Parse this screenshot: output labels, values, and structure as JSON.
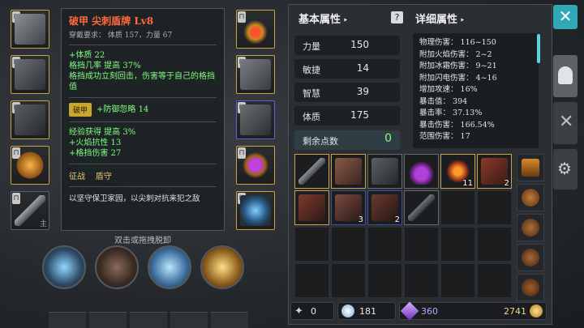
{
  "tooltip": {
    "title": "破甲 尖刺盾牌 Lv8",
    "requirement": "穿戴要求： 体质 157，力量 67",
    "stats": [
      "+体质 22",
      "格挡几率 提高 37%",
      "格挡成功立刻回击，伤害等于自己的格挡值"
    ],
    "set_badge": "破甲",
    "set_bonus": "+防御忽略 14",
    "extra": [
      "经验获得 提高 3%",
      "+火焰抗性 13",
      "+格挡伤害 27"
    ],
    "tags": "征战    盾守",
    "description": "以坚守保卫家园，以尖刺对抗来犯之敌"
  },
  "hint": "双击或拖拽脱卸",
  "slot_tag": "主",
  "panel": {
    "basic_title": "基本属性",
    "detail_title": "详细属性",
    "stats": [
      {
        "label": "力量",
        "value": "150"
      },
      {
        "label": "敏捷",
        "value": "14"
      },
      {
        "label": "智慧",
        "value": "39"
      },
      {
        "label": "体质",
        "value": "175"
      }
    ],
    "points_label": "剩余点数",
    "points_value": "0",
    "details": [
      "物理伤害： 116~150",
      "附加火焰伤害： 2~2",
      "附加冰霜伤害： 9~21",
      "附加闪电伤害： 4~16",
      "增加攻速： 16%",
      "暴击值： 394",
      "暴击率： 37.13%",
      "暴击伤害： 166.54%",
      "范围伤害： 17"
    ]
  },
  "inventory": {
    "counts": {
      "c6": "11",
      "c7": "2",
      "c10": "3",
      "c11": "2"
    }
  },
  "status": {
    "keys": "0",
    "potions": "181",
    "gems": "360",
    "gold": "2741"
  },
  "buttons": {
    "close": "✕"
  },
  "colors": {
    "accent": "#31a9b5",
    "legendary": "#ff6a3c",
    "bonus": "#7fff7f",
    "gold_border": "#c9a24a"
  }
}
